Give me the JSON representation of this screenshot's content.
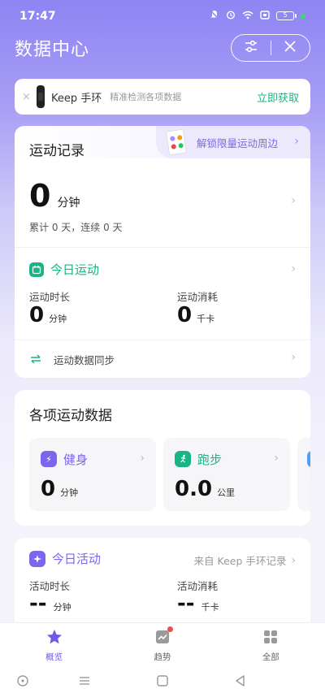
{
  "status": {
    "time": "17:47",
    "battery": "5"
  },
  "header": {
    "title": "数据中心"
  },
  "banner": {
    "close": "×",
    "name": "Keep 手环",
    "desc": "精准检测各项数据",
    "action": "立即获取"
  },
  "record": {
    "title": "运动记录",
    "promo": "解锁限量运动周边",
    "minutes_value": "0",
    "minutes_unit": "分钟",
    "summary": "累计 0 天，连续 0 天",
    "today_title": "今日运动",
    "duration_label": "运动时长",
    "duration_value": "0",
    "duration_unit": "分钟",
    "calories_label": "运动消耗",
    "calories_value": "0",
    "calories_unit": "千卡",
    "sync_label": "运动数据同步"
  },
  "sports": {
    "title": "各项运动数据",
    "tiles": [
      {
        "name": "健身",
        "value": "0",
        "unit": "分钟",
        "color": "#7d66ee"
      },
      {
        "name": "跑步",
        "value": "0.0",
        "unit": "公里",
        "color": "#18b486"
      }
    ]
  },
  "activity": {
    "title": "今日活动",
    "source": "来自 Keep 手环记录",
    "duration_label": "活动时长",
    "duration_value": "--",
    "duration_unit": "分钟",
    "calories_label": "活动消耗",
    "calories_value": "--",
    "calories_unit": "千卡"
  },
  "nav": {
    "items": [
      {
        "label": "概览"
      },
      {
        "label": "趋势"
      },
      {
        "label": "全部"
      }
    ]
  },
  "colors": {
    "accent": "#7d66ee",
    "green": "#18b486"
  }
}
